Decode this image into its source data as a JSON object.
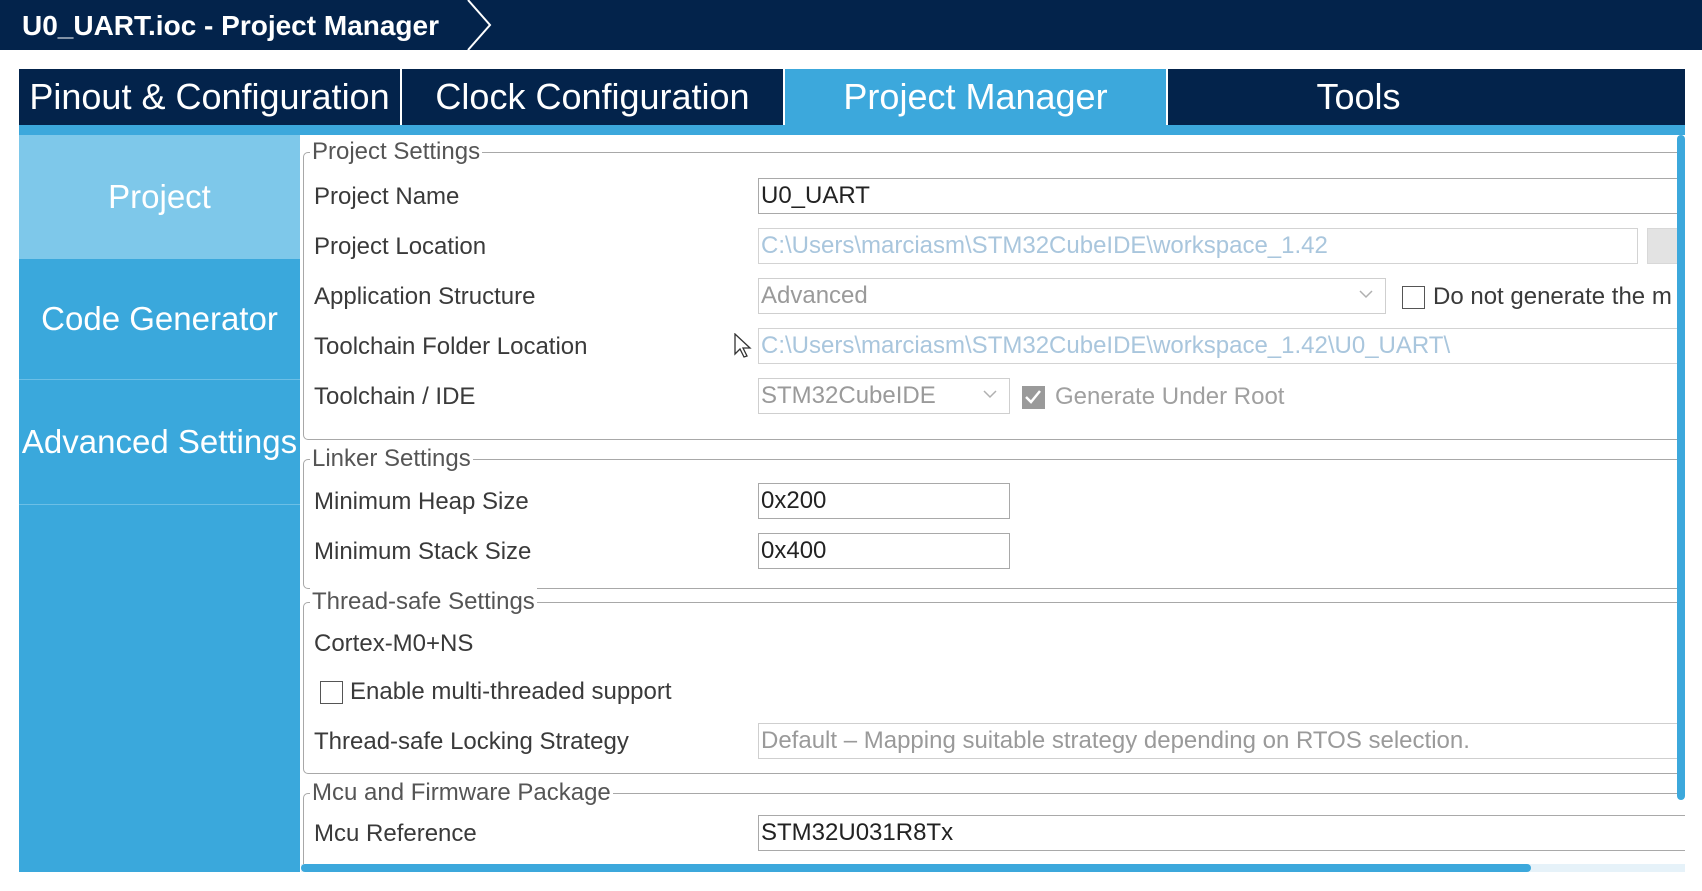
{
  "window": {
    "title": "U0_UART.ioc - Project Manager"
  },
  "tabs": [
    {
      "label": "Pinout & Configuration",
      "active": false
    },
    {
      "label": "Clock Configuration",
      "active": false
    },
    {
      "label": "Project Manager",
      "active": true
    },
    {
      "label": "Tools",
      "active": false
    }
  ],
  "sidebar": {
    "items": [
      {
        "label": "Project",
        "active": true
      },
      {
        "label": "Code Generator",
        "active": false
      },
      {
        "label": "Advanced Settings",
        "active": false
      }
    ]
  },
  "project_settings": {
    "legend": "Project Settings",
    "project_name_label": "Project Name",
    "project_name_value": "U0_UART",
    "project_location_label": "Project Location",
    "project_location_value": "C:\\Users\\marciasm\\STM32CubeIDE\\workspace_1.42",
    "application_structure_label": "Application Structure",
    "application_structure_value": "Advanced",
    "do_not_generate_label": "Do not generate the m",
    "do_not_generate_checked": false,
    "toolchain_folder_label": "Toolchain Folder Location",
    "toolchain_folder_value": "C:\\Users\\marciasm\\STM32CubeIDE\\workspace_1.42\\U0_UART\\",
    "toolchain_ide_label": "Toolchain / IDE",
    "toolchain_ide_value": "STM32CubeIDE",
    "generate_under_root_label": "Generate Under Root",
    "generate_under_root_checked": true
  },
  "linker_settings": {
    "legend": "Linker Settings",
    "min_heap_label": "Minimum Heap Size",
    "min_heap_value": "0x200",
    "min_stack_label": "Minimum Stack Size",
    "min_stack_value": "0x400"
  },
  "thread_safe_settings": {
    "legend": "Thread-safe Settings",
    "core_label": "Cortex-M0+NS",
    "enable_multithread_label": "Enable multi-threaded support",
    "enable_multithread_checked": false,
    "locking_strategy_label": "Thread-safe Locking Strategy",
    "locking_strategy_value": "Default – Mapping suitable strategy depending on RTOS selection."
  },
  "mcu_firmware": {
    "legend": "Mcu and Firmware Package",
    "mcu_reference_label": "Mcu Reference",
    "mcu_reference_value": "STM32U031R8Tx"
  },
  "colors": {
    "title_bar": "#03234b",
    "accent": "#3ca8dc",
    "sidebar_active": "#7ec8ea",
    "disabled_text": "#a9c6dd"
  },
  "icons": {
    "title_chevron": "chevron-right-icon",
    "dropdown": "chevron-down-icon",
    "cursor": "mouse-pointer-icon"
  }
}
